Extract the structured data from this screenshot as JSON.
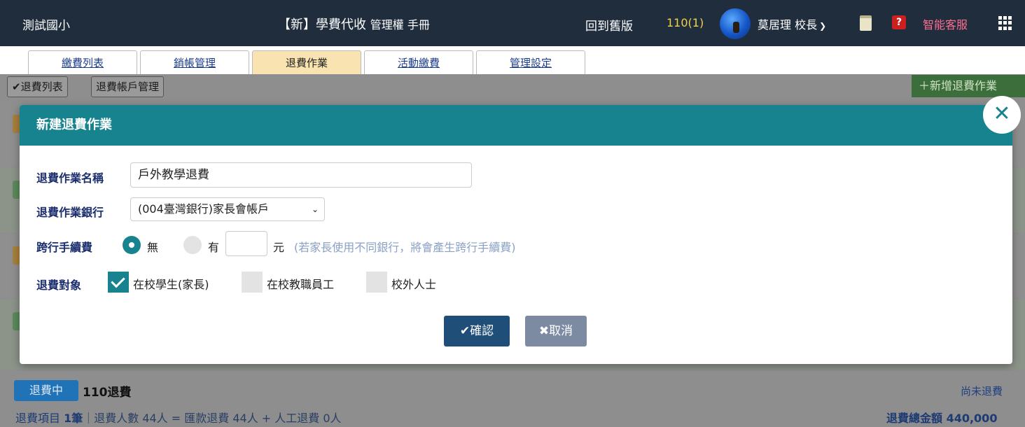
{
  "header": {
    "school": "測試國小",
    "app_title": "【新】學費代收",
    "app_subtitle": "管理權 手冊",
    "old_version": "回到舊版",
    "term": "110(1)",
    "user": "莫居理 校長",
    "service": "智能客服",
    "help_icon_text": "?"
  },
  "tabs": [
    {
      "label": "繳費列表"
    },
    {
      "label": "銷帳管理"
    },
    {
      "label": "退費作業"
    },
    {
      "label": "活動繳費"
    },
    {
      "label": "管理設定"
    }
  ],
  "subbar": {
    "list_btn": "✔退費列表",
    "account_btn": "退費帳戶管理",
    "add_btn": "＋新增退費作業"
  },
  "modal": {
    "title": "新建退費作業",
    "close_label": "✕",
    "name_label": "退費作業名稱",
    "name_value": "戶外教學退費",
    "bank_label": "退費作業銀行",
    "bank_value": "(004臺灣銀行)家長會帳戶",
    "fee_label": "跨行手續費",
    "fee_no": "無",
    "fee_yes": "有",
    "fee_unit": "元",
    "fee_hint": "(若家長使用不同銀行，將會產生跨行手續費)",
    "target_label": "退費對象",
    "targets": [
      {
        "label": "在校學生(家長)",
        "checked": true
      },
      {
        "label": "在校教職員工",
        "checked": false
      },
      {
        "label": "校外人士",
        "checked": false
      }
    ],
    "confirm": "✔確認",
    "cancel": "✖取消"
  },
  "record": {
    "badge": "退費中",
    "title": "110退費",
    "status": "尚未退費",
    "summary_prefix": "退費項目 ",
    "summary_count": "1筆",
    "summary_rest": "｜退費人數 44人 = 匯款退費 44人 + 人工退費 0人",
    "total": "退費總金額 440,000"
  },
  "colors": {
    "topbar": "#1f2d3d",
    "modal_header": "#17838f",
    "confirm": "#1f4e79",
    "cancel": "#7c8aa2",
    "badge": "#2173b8"
  }
}
